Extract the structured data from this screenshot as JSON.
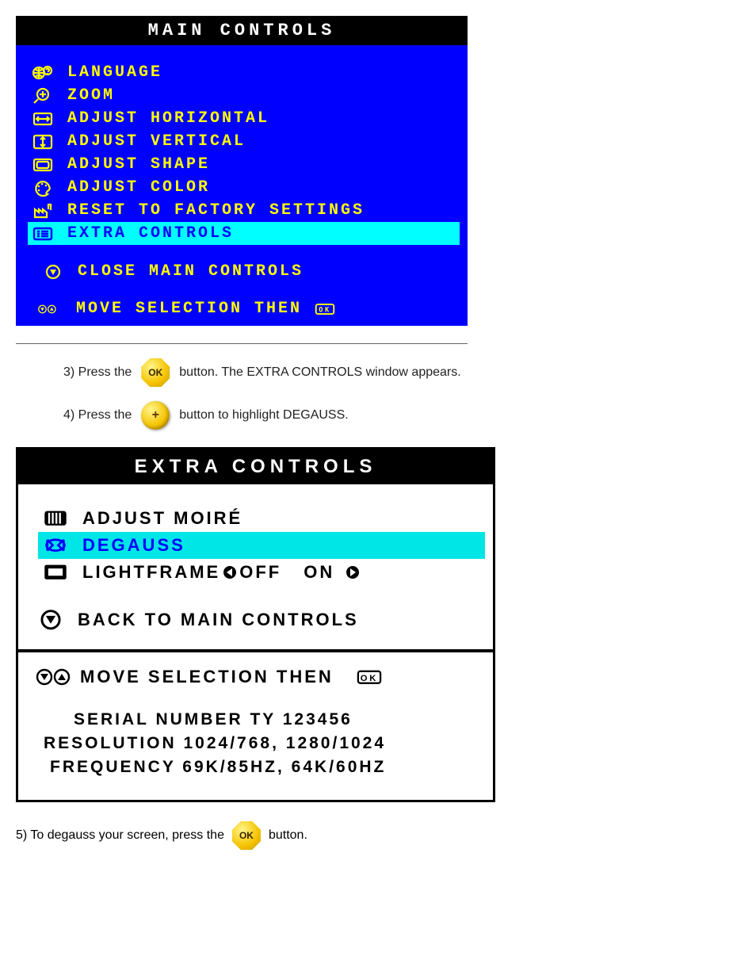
{
  "main": {
    "title": "MAIN CONTROLS",
    "items": [
      {
        "label": "LANGUAGE"
      },
      {
        "label": "ZOOM"
      },
      {
        "label": "ADJUST HORIZONTAL"
      },
      {
        "label": "ADJUST VERTICAL"
      },
      {
        "label": "ADJUST SHAPE"
      },
      {
        "label": "ADJUST COLOR"
      },
      {
        "label": "RESET TO FACTORY SETTINGS"
      },
      {
        "label": "EXTRA CONTROLS"
      }
    ],
    "close_label": "CLOSE MAIN CONTROLS",
    "footer_text": "MOVE SELECTION THEN"
  },
  "steps": {
    "s3_prefix": "3) Press the ",
    "s3_suffix": " button. The EXTRA CONTROLS window appears.",
    "s4_prefix": "4) Press the ",
    "s4_suffix": " button to highlight DEGAUSS."
  },
  "extra": {
    "title": "EXTRA CONTROLS",
    "items": [
      {
        "label": "ADJUST MOIRÉ"
      },
      {
        "label": "DEGAUSS"
      },
      {
        "label_pre": "LIGHTFRAME",
        "off": "OFF",
        "on": "ON"
      }
    ],
    "back_label": "BACK TO MAIN CONTROLS",
    "footer_text": "MOVE SELECTION THEN",
    "serial_label": "SERIAL NUMBER TY 123456",
    "resolution_label": "RESOLUTION 1024/768, 1280/1024",
    "frequency_label": "FREQUENCY 69K/85HZ, 64K/60HZ"
  },
  "bottom": {
    "prefix": "5) To degauss your screen, press the ",
    "suffix": " button."
  },
  "buttons": {
    "ok": "OK",
    "plus": "+"
  }
}
